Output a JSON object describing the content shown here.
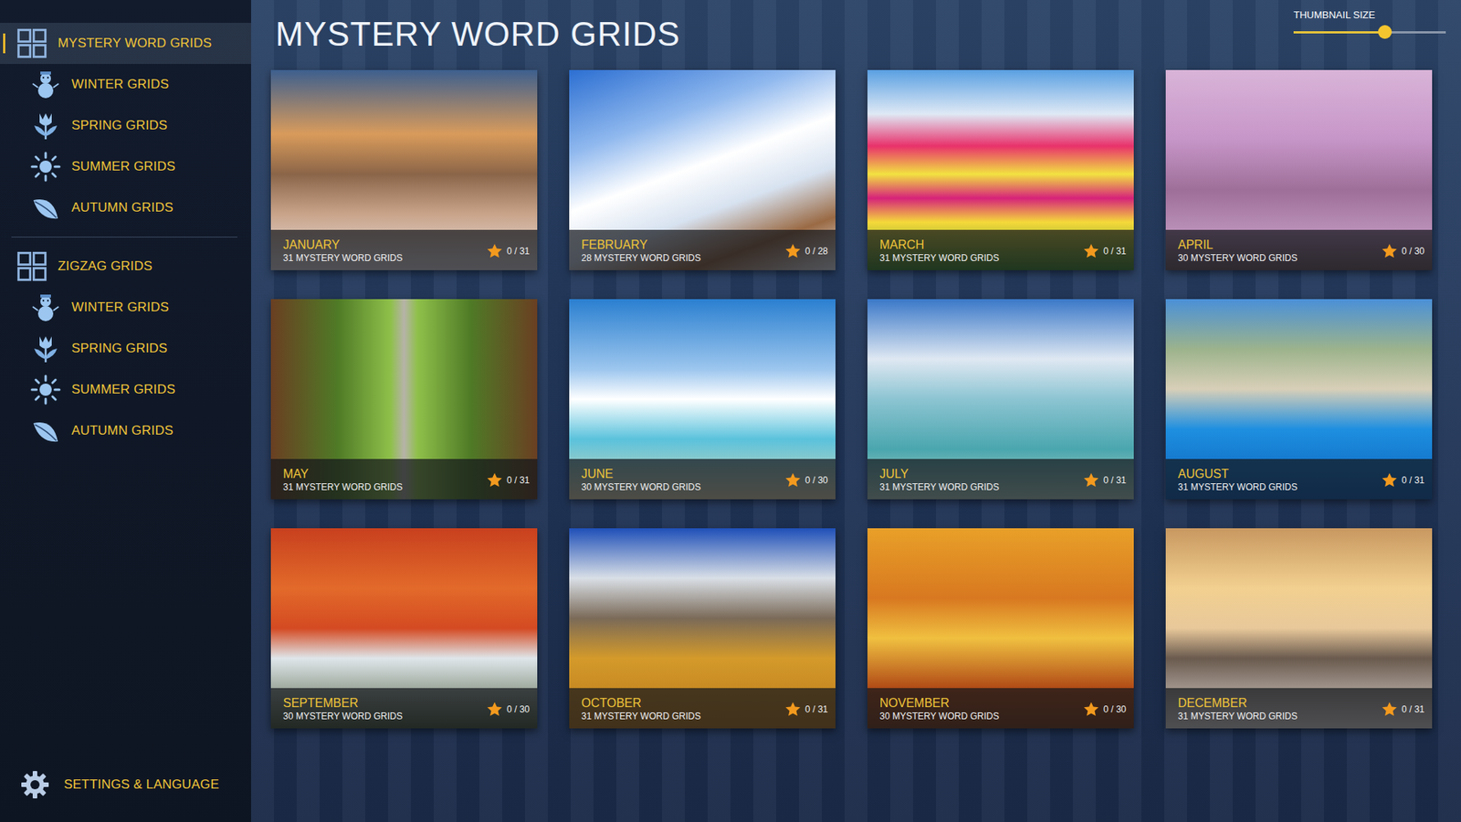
{
  "sidebar": {
    "groups": [
      {
        "label": "MYSTERY WORD GRIDS",
        "selected": true,
        "children": [
          {
            "label": "WINTER GRIDS",
            "kind": "winter",
            "selected": false
          },
          {
            "label": "SPRING GRIDS",
            "kind": "spring",
            "selected": false
          },
          {
            "label": "SUMMER GRIDS",
            "kind": "summer",
            "selected": false
          },
          {
            "label": "AUTUMN GRIDS",
            "kind": "autumn",
            "selected": false
          }
        ]
      },
      {
        "label": "ZIGZAG GRIDS",
        "selected": false,
        "children": [
          {
            "label": "WINTER GRIDS",
            "kind": "winter",
            "selected": false
          },
          {
            "label": "SPRING GRIDS",
            "kind": "spring",
            "selected": false
          },
          {
            "label": "SUMMER GRIDS",
            "kind": "summer",
            "selected": false
          },
          {
            "label": "AUTUMN GRIDS",
            "kind": "autumn",
            "selected": false
          }
        ]
      }
    ],
    "settings": {
      "label": "SETTINGS & LANGUAGE"
    }
  },
  "page": {
    "title": "MYSTERY WORD GRIDS"
  },
  "thumbnail_slider": {
    "label": "THUMBNAIL SIZE",
    "level": 0.6
  },
  "cards": [
    {
      "month": "JANUARY",
      "subtitle": "31 MYSTERY WORD GRIDS",
      "progress": "0 / 31"
    },
    {
      "month": "FEBRUARY",
      "subtitle": "28 MYSTERY WORD GRIDS",
      "progress": "0 / 28"
    },
    {
      "month": "MARCH",
      "subtitle": "31 MYSTERY WORD GRIDS",
      "progress": "0 / 31"
    },
    {
      "month": "APRIL",
      "subtitle": "30 MYSTERY WORD GRIDS",
      "progress": "0 / 30"
    },
    {
      "month": "MAY",
      "subtitle": "31 MYSTERY WORD GRIDS",
      "progress": "0 / 31"
    },
    {
      "month": "JUNE",
      "subtitle": "30 MYSTERY WORD GRIDS",
      "progress": "0 / 30"
    },
    {
      "month": "JULY",
      "subtitle": "31 MYSTERY WORD GRIDS",
      "progress": "0 / 31"
    },
    {
      "month": "AUGUST",
      "subtitle": "31 MYSTERY WORD GRIDS",
      "progress": "0 / 31"
    },
    {
      "month": "SEPTEMBER",
      "subtitle": "30 MYSTERY WORD GRIDS",
      "progress": "0 / 30"
    },
    {
      "month": "OCTOBER",
      "subtitle": "31 MYSTERY WORD GRIDS",
      "progress": "0 / 31"
    },
    {
      "month": "NOVEMBER",
      "subtitle": "30 MYSTERY WORD GRIDS",
      "progress": "0 / 30"
    },
    {
      "month": "DECEMBER",
      "subtitle": "31 MYSTERY WORD GRIDS",
      "progress": "0 / 31"
    }
  ]
}
